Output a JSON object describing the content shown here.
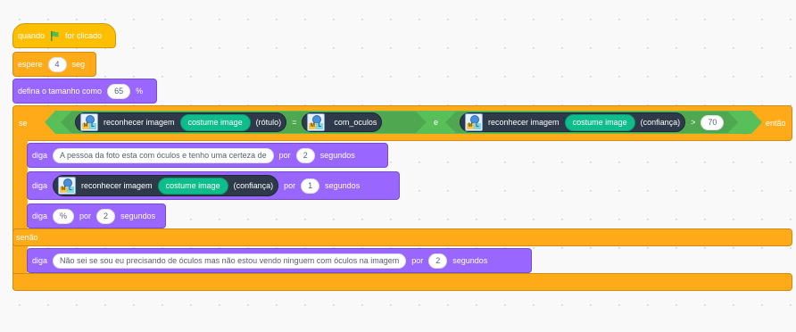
{
  "event": {
    "when_label": "quando",
    "clicked_label": "for clicado",
    "flag_color": "#4cbf56"
  },
  "wait": {
    "label": "espere",
    "value": "4",
    "unit": "seg"
  },
  "size": {
    "label": "defina o tamanho como",
    "value": "65",
    "unit": "%"
  },
  "if_block": {
    "if_label": "se",
    "then_label": "então",
    "else_label": "senão",
    "and_label": "e",
    "equals_label": "=",
    "gt_label": ">",
    "left_reporter": {
      "label": "reconhecer imagem",
      "costume": "costume image",
      "prop": "(rótulo)"
    },
    "right_reporter_label": "com_oculos",
    "conf_reporter": {
      "label": "reconhecer imagem",
      "costume": "costume image",
      "prop": "(confiança)"
    },
    "threshold": "70"
  },
  "say1": {
    "label": "diga",
    "text": "A pessoa da foto esta com óculos e tenho uma certeza de",
    "por": "por",
    "secs": "2",
    "unit": "segundos"
  },
  "say2": {
    "label": "diga",
    "reporter_label": "reconhecer imagem",
    "costume": "costume image",
    "prop": "(confiança)",
    "por": "por",
    "secs": "1",
    "unit": "segundos"
  },
  "say3": {
    "label": "diga",
    "text": "%",
    "por": "por",
    "secs": "2",
    "unit": "segundos"
  },
  "say4": {
    "label": "diga",
    "text": "Não sei se sou eu precisando de óculos mas não estou vendo ninguem com óculos na imagem",
    "por": "por",
    "secs": "2",
    "unit": "segundos"
  },
  "ml_icon": {
    "m": "M",
    "l": "L"
  },
  "colors": {
    "control": "#ffab19",
    "events": "#ffbf00",
    "looks": "#9966ff",
    "operators": "#59c059",
    "extension": "#0fbd8c"
  }
}
